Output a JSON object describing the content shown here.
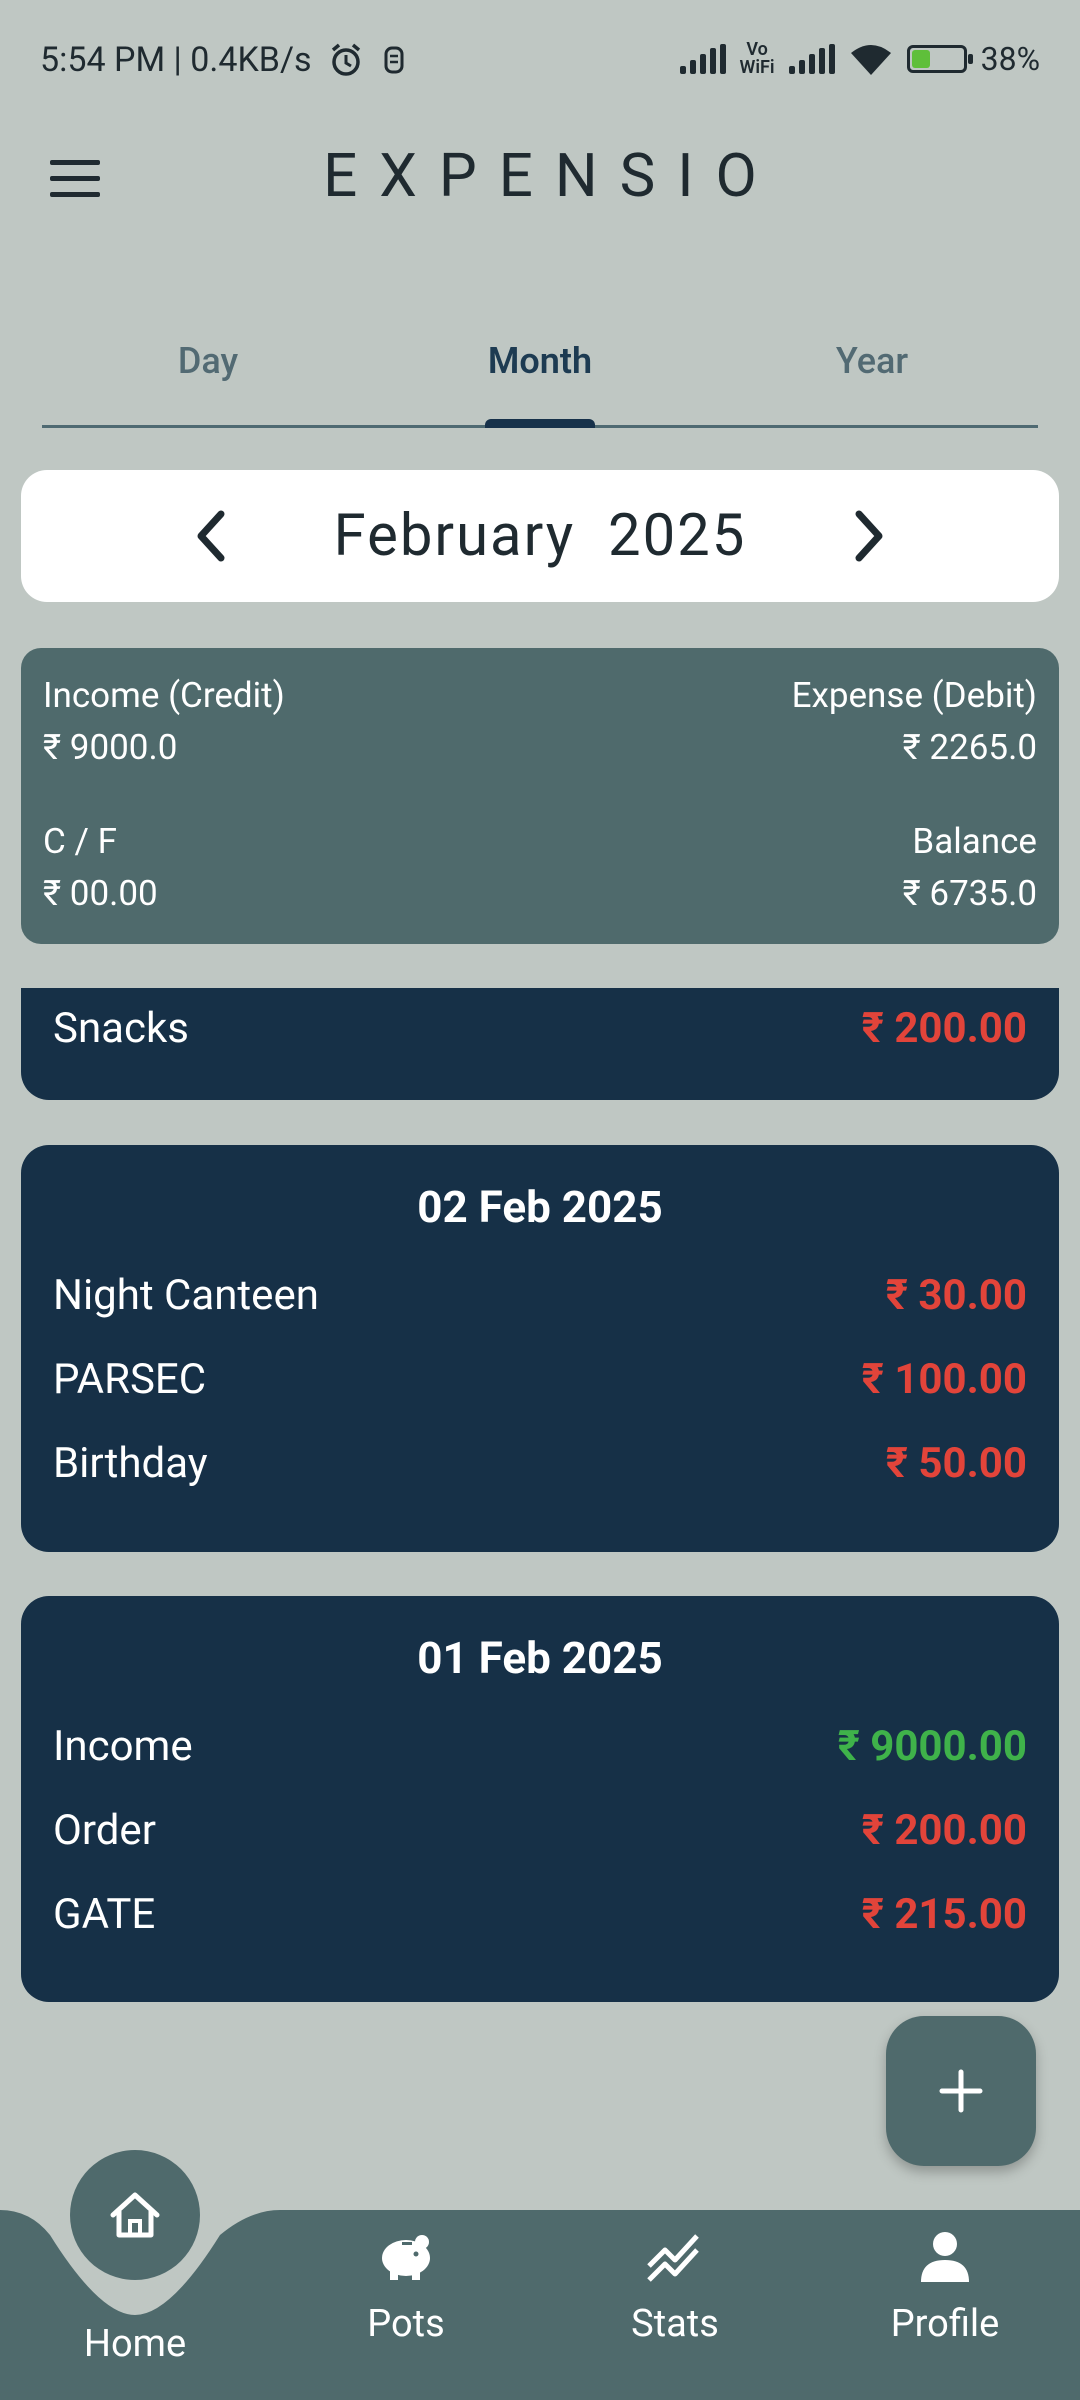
{
  "status": {
    "time_speed": "5:54 PM | 0.4KB/s",
    "battery": "38%",
    "vowifi": "Vo WiFi"
  },
  "app": {
    "title": "EXPENSIO"
  },
  "tabs": [
    {
      "label": "Day"
    },
    {
      "label": "Month"
    },
    {
      "label": "Year"
    }
  ],
  "month_selector": {
    "month": "February",
    "year": "2025"
  },
  "summary": {
    "income_label": "Income (Credit)",
    "income_value": "₹ 9000.0",
    "expense_label": "Expense (Debit)",
    "expense_value": "₹ 2265.0",
    "cf_label": "C / F",
    "cf_value": "₹ 00.00",
    "balance_label": "Balance",
    "balance_value": "₹ 6735.0"
  },
  "partial_card": {
    "label": "Snacks",
    "amount": "₹ 200.00"
  },
  "days": [
    {
      "date": "02 Feb 2025",
      "items": [
        {
          "label": "Night Canteen",
          "amount": "₹ 30.00",
          "type": "debit"
        },
        {
          "label": "PARSEC",
          "amount": "₹ 100.00",
          "type": "debit"
        },
        {
          "label": "Birthday",
          "amount": "₹ 50.00",
          "type": "debit"
        }
      ]
    },
    {
      "date": "01 Feb 2025",
      "items": [
        {
          "label": "Income",
          "amount": "₹ 9000.00",
          "type": "credit"
        },
        {
          "label": "Order",
          "amount": "₹ 200.00",
          "type": "debit"
        },
        {
          "label": "GATE",
          "amount": "₹ 215.00",
          "type": "debit"
        }
      ]
    }
  ],
  "bottom_nav": {
    "home": "Home",
    "pots": "Pots",
    "stats": "Stats",
    "profile": "Profile"
  },
  "colors": {
    "background": "#bfc7c3",
    "card": "#163047",
    "summary": "#4f6a6c",
    "debit": "#e2443a",
    "credit": "#3fb24a"
  }
}
